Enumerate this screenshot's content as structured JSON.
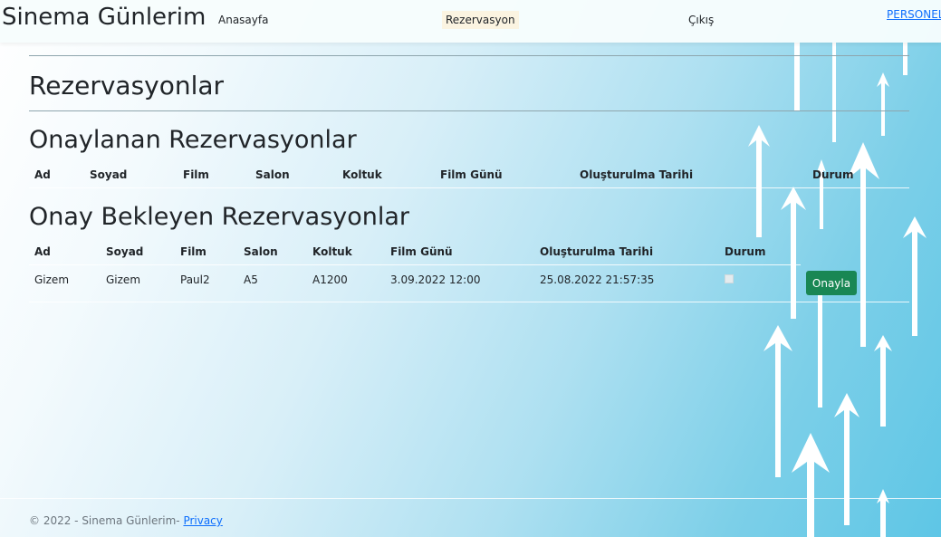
{
  "brand": "Sinema Günlerim",
  "nav": {
    "home": "Anasayfa",
    "reservation": "Rezervasyon",
    "exit": "Çıkış",
    "staff": "PERSONEL"
  },
  "page_title": "Rezervasyonlar",
  "approved": {
    "title": "Onaylanan Rezervasyonlar",
    "headers": [
      "Ad",
      "Soyad",
      "Film",
      "Salon",
      "Koltuk",
      "Film Günü",
      "Oluşturulma Tarihi",
      "Durum"
    ]
  },
  "pending": {
    "title": "Onay Bekleyen Rezervasyonlar",
    "headers": [
      "Ad",
      "Soyad",
      "Film",
      "Salon",
      "Koltuk",
      "Film Günü",
      "Oluşturulma Tarihi",
      "Durum"
    ],
    "rows": [
      {
        "ad": "Gizem",
        "soyad": "Gizem",
        "film": "Paul2",
        "salon": "A5",
        "koltuk": "A1200",
        "film_gunu": "3.09.2022 12:00",
        "olusturulma": "25.08.2022 21:57:35",
        "durum_checked": false,
        "action": "Onayla"
      }
    ]
  },
  "footer": {
    "text": "© 2022 - Sinema Günlerim- ",
    "privacy": "Privacy"
  },
  "colors": {
    "approve_button": "#198754",
    "link": "#0d6efd"
  }
}
